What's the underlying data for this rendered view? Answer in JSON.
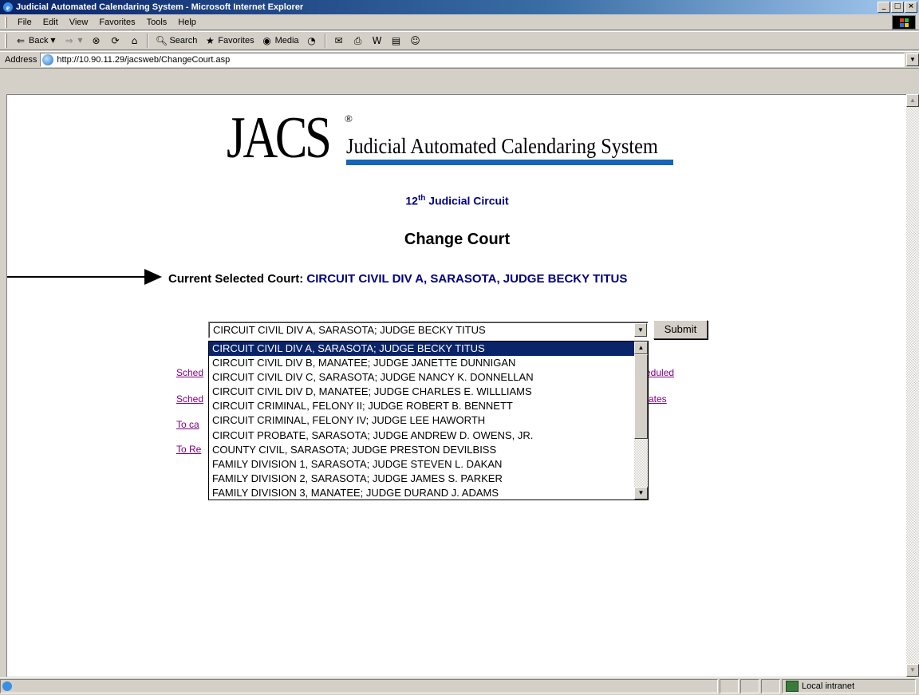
{
  "window": {
    "title": "Judicial Automated Calendaring System - Microsoft Internet Explorer",
    "controls": [
      "_",
      "□",
      "×"
    ]
  },
  "menu": [
    "File",
    "Edit",
    "View",
    "Favorites",
    "Tools",
    "Help"
  ],
  "toolbar": {
    "back": "Back",
    "search": "Search",
    "favorites": "Favorites",
    "media": "Media"
  },
  "address": {
    "label": "Address",
    "url": "http://10.90.11.29/jacsweb/ChangeCourt.asp"
  },
  "logo": {
    "mark": "JACS",
    "registered": "®",
    "subtitle": "Judicial Automated Calendaring System"
  },
  "circuit": {
    "number": "12",
    "suffix": "th",
    "name": "Judicial Circuit"
  },
  "page": {
    "title": "Change Court",
    "current_label": "Current Selected Court:",
    "current_value": "CIRCUIT CIVIL DIV A, SARASOTA, JUDGE BECKY TITUS"
  },
  "court_select": {
    "selected": "CIRCUIT CIVIL DIV A, SARASOTA; JUDGE BECKY TITUS",
    "options": [
      "CIRCUIT CIVIL DIV A, SARASOTA; JUDGE BECKY TITUS",
      "CIRCUIT CIVIL DIV B, MANATEE; JUDGE JANETTE DUNNIGAN",
      "CIRCUIT CIVIL DIV C, SARASOTA; JUDGE NANCY K. DONNELLAN",
      "CIRCUIT CIVIL DIV D, MANATEE; JUDGE CHARLES E. WILLLIAMS",
      "CIRCUIT CRIMINAL, FELONY II; JUDGE ROBERT B. BENNETT",
      "CIRCUIT CRIMINAL, FELONY IV; JUDGE LEE HAWORTH",
      "CIRCUIT PROBATE, SARASOTA; JUDGE ANDREW D. OWENS, JR.",
      "COUNTY CIVIL, SARASOTA; JUDGE PRESTON DEVILBISS",
      "FAMILY DIVISION 1, SARASOTA; JUDGE STEVEN L. DAKAN",
      "FAMILY DIVISION 2, SARASOTA; JUDGE JAMES S. PARKER",
      "FAMILY DIVISION 3, MANATEE; JUDGE DURAND J. ADAMS"
    ],
    "submit": "Submit"
  },
  "links": {
    "link1_left": "Sched",
    "link1_right": "eduled",
    "link2_left": "Sched",
    "link2_right": "ates",
    "link3_left": "To ca",
    "link4_left": "To Re"
  },
  "status": {
    "zone": "Local intranet"
  }
}
